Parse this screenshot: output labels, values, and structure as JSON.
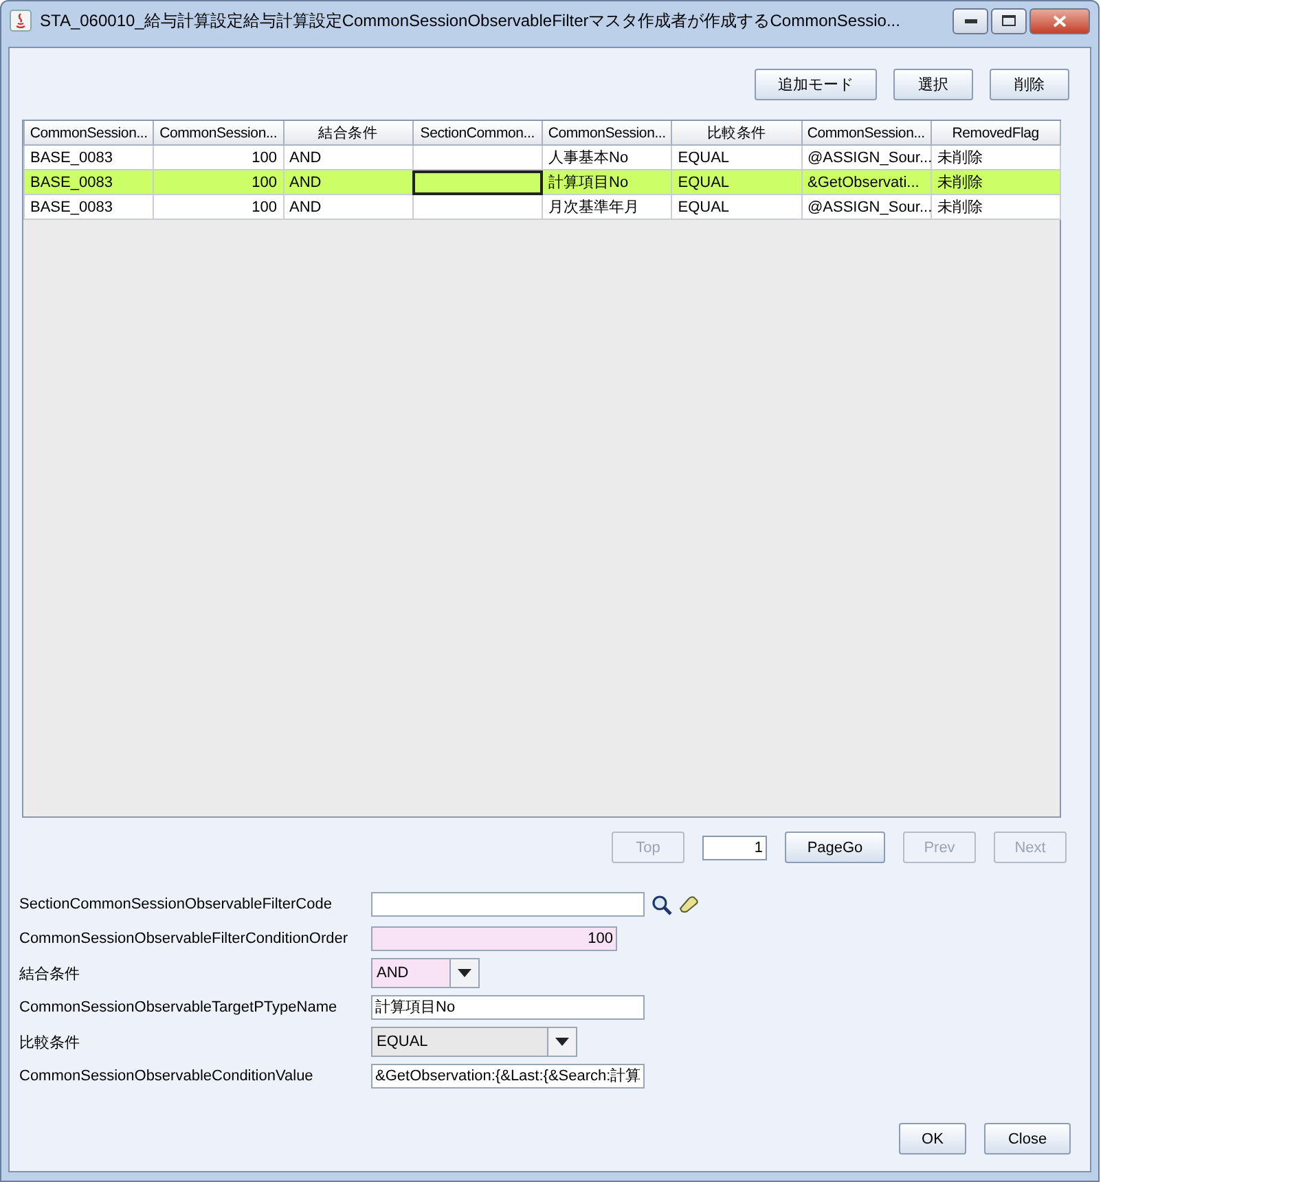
{
  "window": {
    "title": "STA_060010_給与計算設定給与計算設定CommonSessionObservableFilterマスタ作成者が作成するCommonSessio..."
  },
  "toolbar": [
    {
      "label": "追加モード"
    },
    {
      "label": "選択"
    },
    {
      "label": "削除"
    }
  ],
  "table": {
    "columns": [
      {
        "label": "CommonSession...",
        "kind": "text"
      },
      {
        "label": "CommonSession...",
        "kind": "number"
      },
      {
        "label": "結合条件",
        "kind": "text"
      },
      {
        "label": "SectionCommon...",
        "kind": "text"
      },
      {
        "label": "CommonSession...",
        "kind": "text"
      },
      {
        "label": "比較条件",
        "kind": "text"
      },
      {
        "label": "CommonSession...",
        "kind": "text"
      },
      {
        "label": "RemovedFlag",
        "kind": "text"
      }
    ],
    "rows": [
      {
        "selected": false,
        "cells": [
          {
            "text": "BASE_0083",
            "focused": false
          },
          {
            "text": "100",
            "focused": false
          },
          {
            "text": "AND",
            "focused": false
          },
          {
            "focused": false
          },
          {
            "text": "人事基本No",
            "focused": false
          },
          {
            "text": "EQUAL",
            "focused": false
          },
          {
            "text": "@ASSIGN_Sour...",
            "focused": false
          },
          {
            "text": "未削除",
            "focused": false
          }
        ]
      },
      {
        "selected": true,
        "cells": [
          {
            "text": "BASE_0083",
            "focused": false
          },
          {
            "text": "100",
            "focused": false
          },
          {
            "text": "AND",
            "focused": false
          },
          {
            "focused": true
          },
          {
            "text": "計算項目No",
            "focused": false
          },
          {
            "text": "EQUAL",
            "focused": false
          },
          {
            "text": "&GetObservati...",
            "focused": false
          },
          {
            "text": "未削除",
            "focused": false
          }
        ]
      },
      {
        "selected": false,
        "cells": [
          {
            "text": "BASE_0083",
            "focused": false
          },
          {
            "text": "100",
            "focused": false
          },
          {
            "text": "AND",
            "focused": false
          },
          {
            "focused": false
          },
          {
            "text": "月次基準年月",
            "focused": false
          },
          {
            "text": "EQUAL",
            "focused": false
          },
          {
            "text": "@ASSIGN_Sour...",
            "focused": false
          },
          {
            "text": "未削除",
            "focused": false
          }
        ]
      }
    ]
  },
  "pager": [
    {
      "kind": "button",
      "label": "Top",
      "disabled": true
    },
    {
      "kind": "field",
      "value": "1"
    },
    {
      "kind": "button",
      "label": "PageGo",
      "disabled": false
    },
    {
      "kind": "button",
      "label": "Prev",
      "disabled": true
    },
    {
      "kind": "button",
      "label": "Next",
      "disabled": true
    }
  ],
  "form": [
    {
      "label": "SectionCommonSessionObservableFilterCode",
      "kind": "lookup",
      "required": false
    },
    {
      "label": "CommonSessionObservableFilterConditionOrder",
      "kind": "number",
      "value": "100",
      "required": true
    },
    {
      "label": "結合条件",
      "kind": "combo",
      "value": "AND",
      "required": true
    },
    {
      "label": "CommonSessionObservableTargetPTypeName",
      "kind": "text",
      "value": "計算項目No",
      "required": false
    },
    {
      "label": "比較条件",
      "kind": "combo",
      "value": "EQUAL",
      "required": false
    },
    {
      "label": "CommonSessionObservableConditionValue",
      "kind": "text",
      "value": "&GetObservation:{&Last:{&Search:計算",
      "required": false
    }
  ],
  "footer": [
    {
      "label": "OK"
    },
    {
      "label": "Close"
    }
  ]
}
